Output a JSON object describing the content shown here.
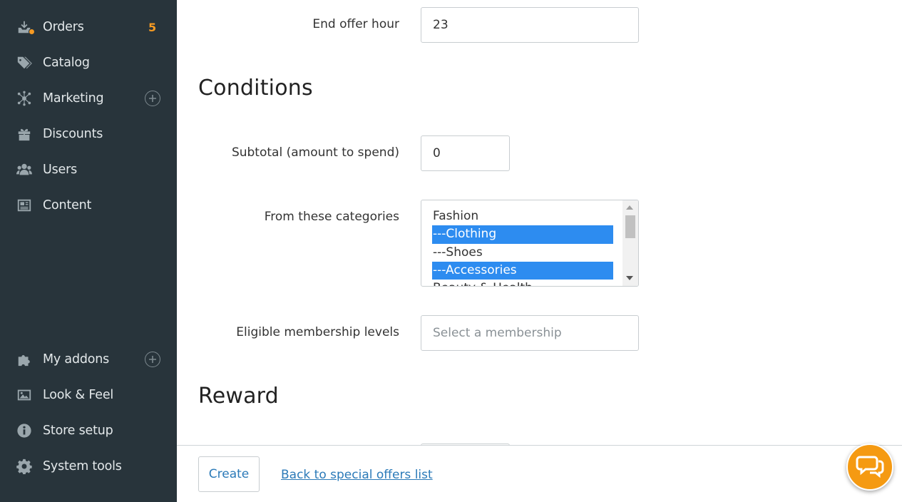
{
  "sidebar": {
    "items": [
      {
        "label": "Orders",
        "icon": "orders-icon",
        "badge": "5"
      },
      {
        "label": "Catalog",
        "icon": "tag-icon"
      },
      {
        "label": "Marketing",
        "icon": "network-icon"
      },
      {
        "label": "Discounts",
        "icon": "gift-icon"
      },
      {
        "label": "Users",
        "icon": "users-icon"
      },
      {
        "label": "Content",
        "icon": "newspaper-icon"
      },
      {
        "label": "My addons",
        "icon": "puzzle-icon"
      },
      {
        "label": "Look & Feel",
        "icon": "image-icon"
      },
      {
        "label": "Store setup",
        "icon": "info-icon"
      },
      {
        "label": "System tools",
        "icon": "gear-icon"
      }
    ]
  },
  "form": {
    "end_offer_hour": {
      "label": "End offer hour",
      "value": "23"
    },
    "conditions_title": "Conditions",
    "subtotal": {
      "label": "Subtotal (amount to spend)",
      "value": "0"
    },
    "categories": {
      "label": "From these categories",
      "options": [
        {
          "text": "Fashion",
          "selected": false
        },
        {
          "text": "---Clothing",
          "selected": true
        },
        {
          "text": "---Shoes",
          "selected": false
        },
        {
          "text": "---Accessories",
          "selected": true
        },
        {
          "text": "Beauty & Health",
          "selected": false
        }
      ]
    },
    "membership": {
      "label": "Eligible membership levels",
      "placeholder": "Select a membership"
    },
    "reward_title": "Reward"
  },
  "footer": {
    "create_label": "Create",
    "back_link": "Back to special offers list"
  },
  "colors": {
    "sidebar_bg": "#28343b",
    "accent_orange": "#f59a23",
    "link_blue": "#2b7ab8",
    "selection_blue": "#2d8cf0"
  }
}
